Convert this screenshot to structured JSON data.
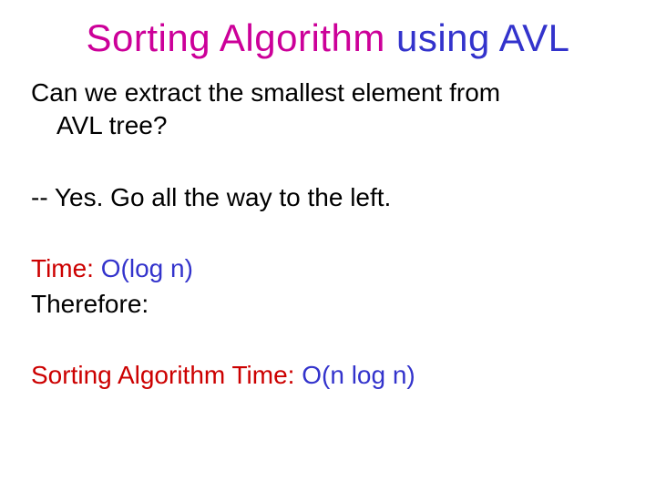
{
  "title": {
    "part1": "Sorting Algorithm ",
    "part2": "using AVL"
  },
  "question": {
    "line1": "Can we extract the smallest element from",
    "line2": "AVL tree?"
  },
  "answer": "-- Yes. Go all the way to the left.",
  "time": {
    "label": "Time: ",
    "value": "O(log n)"
  },
  "therefore": "Therefore:",
  "sorting": {
    "label": "Sorting Algorithm Time: ",
    "value": "O(n log n)"
  }
}
